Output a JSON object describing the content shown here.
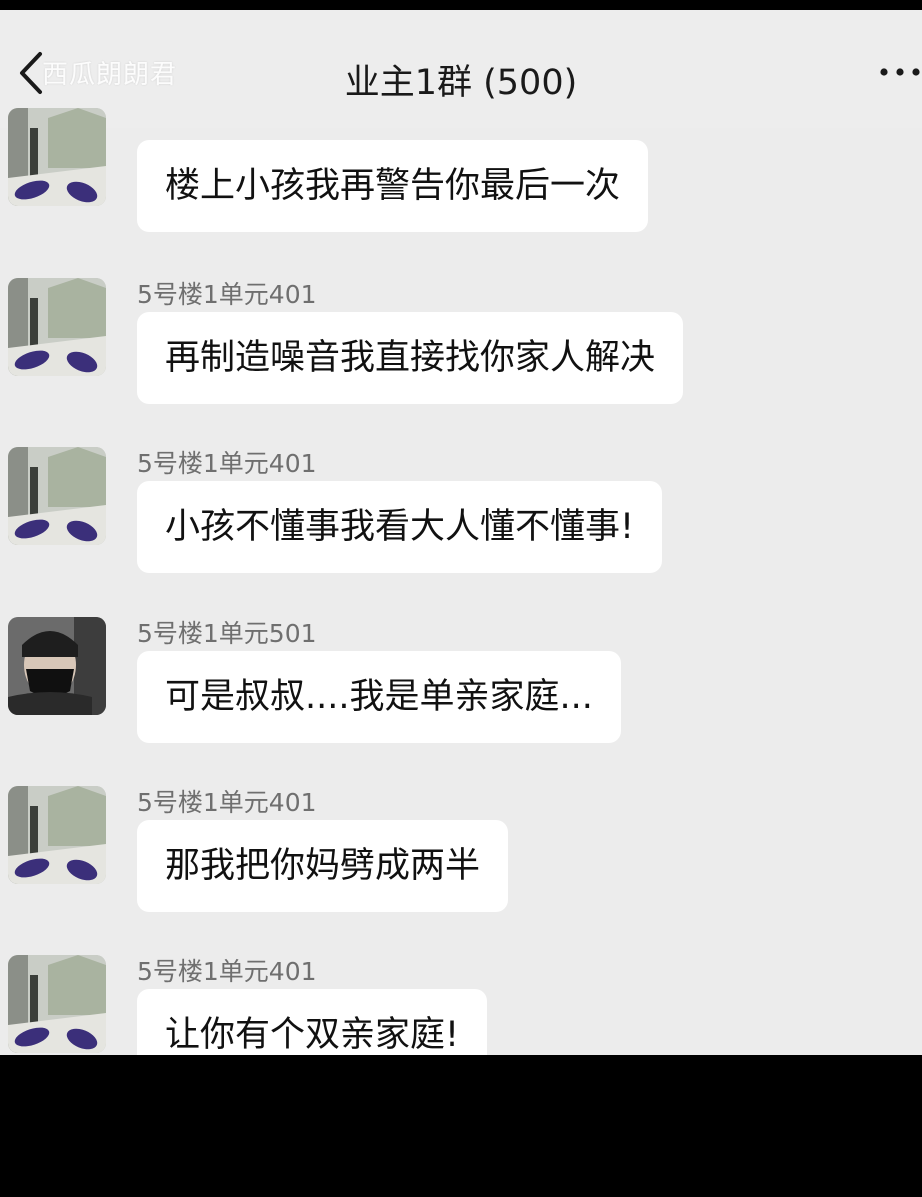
{
  "header": {
    "back_watermark": "西瓜朗朗君",
    "title": "业主1群 (500)"
  },
  "messages": [
    {
      "sender": "",
      "text": "楼上小孩我再警告你最后一次",
      "avatar": "scene-avatar"
    },
    {
      "sender": "5号楼1单元401",
      "text": "再制造噪音我直接找你家人解决",
      "avatar": "scene-avatar"
    },
    {
      "sender": "5号楼1单元401",
      "text": "小孩不懂事我看大人懂不懂事!",
      "avatar": "scene-avatar"
    },
    {
      "sender": "5号楼1单元501",
      "text": "可是叔叔....我是单亲家庭...",
      "avatar": "person-mask-avatar"
    },
    {
      "sender": "5号楼1单元401",
      "text": "那我把你妈劈成两半",
      "avatar": "scene-avatar"
    },
    {
      "sender": "5号楼1单元401",
      "text": "让你有个双亲家庭!",
      "avatar": "scene-avatar"
    }
  ],
  "colors": {
    "background": "#ececec",
    "bubble": "#ffffff",
    "sender_text": "#6f6f6f"
  }
}
